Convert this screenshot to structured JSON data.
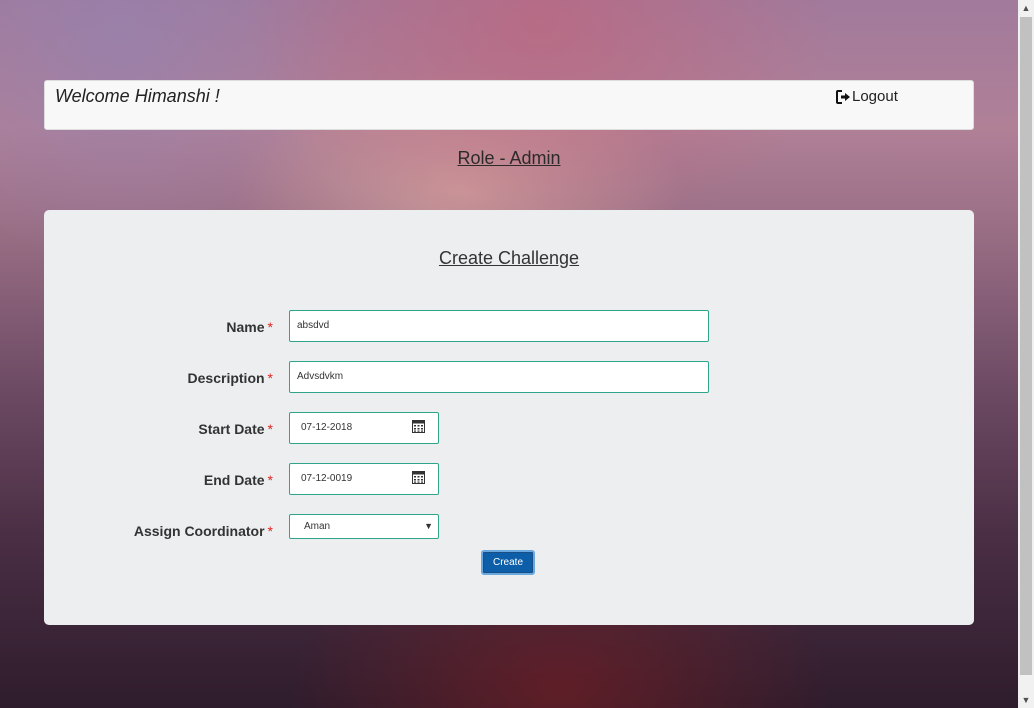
{
  "header": {
    "welcome_text": "Welcome Himanshi !",
    "logout_label": "Logout",
    "logout_icon": "sign-out-icon"
  },
  "role_text": "Role - Admin",
  "form": {
    "title": "Create Challenge",
    "required_mark": "*",
    "name": {
      "label": "Name",
      "value": "absdvd"
    },
    "description": {
      "label": "Description",
      "value": "Advsdvkm"
    },
    "start_date": {
      "label": "Start Date",
      "value": "07-12-2018",
      "icon": "calendar-icon"
    },
    "end_date": {
      "label": "End Date",
      "value": "07-12-0019",
      "icon": "calendar-icon"
    },
    "coordinator": {
      "label": "Assign Coordinator",
      "selected": "Aman"
    },
    "submit_label": "Create"
  },
  "colors": {
    "field_border": "#2ea58a",
    "required": "#e0231d",
    "button_bg": "#0d5ea8",
    "panel_bg": "#eceeef"
  }
}
